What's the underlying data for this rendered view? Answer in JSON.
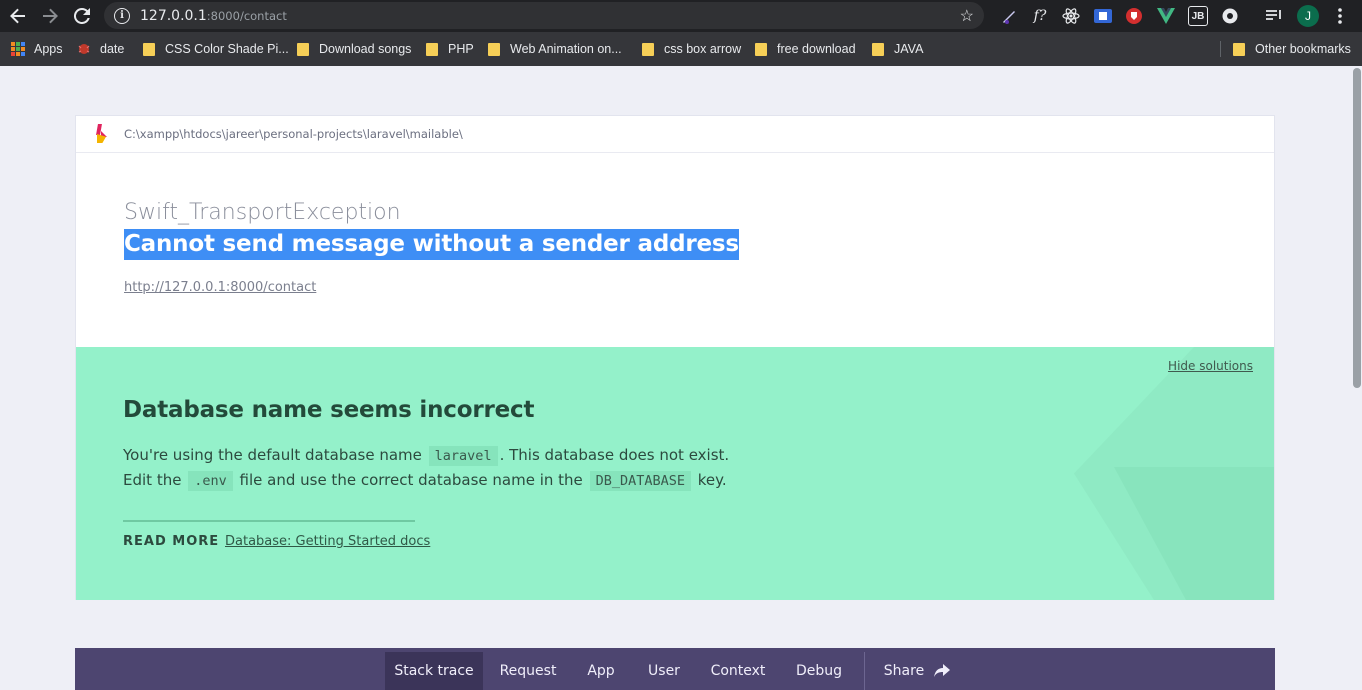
{
  "browser": {
    "url_host": "127.0.0.1",
    "url_path": ":8000/contact",
    "extensions": [
      "f?",
      "JB",
      "J"
    ],
    "bookmarks": [
      {
        "label": "Apps",
        "type": "apps"
      },
      {
        "label": "date",
        "type": "site"
      },
      {
        "label": "CSS Color Shade Pi...",
        "type": "folder"
      },
      {
        "label": "Download songs",
        "type": "folder"
      },
      {
        "label": "PHP",
        "type": "folder"
      },
      {
        "label": "Web Animation on...",
        "type": "folder"
      },
      {
        "label": "css box arrow",
        "type": "folder"
      },
      {
        "label": "free download",
        "type": "folder"
      },
      {
        "label": "JAVA",
        "type": "folder"
      },
      {
        "label": "Other bookmarks",
        "type": "folder"
      }
    ]
  },
  "page": {
    "path": "C:\\xampp\\htdocs\\jareer\\personal-projects\\laravel\\mailable\\",
    "exception_class": "Swift_TransportException",
    "exception_message": "Cannot send message without a sender address",
    "exception_url": "http://127.0.0.1:8000/contact",
    "solution": {
      "hide_label": "Hide solutions",
      "title": "Database name seems incorrect",
      "line1_a": "You're using the default database name",
      "line1_code": "laravel",
      "line1_b": ". This database does not exist.",
      "line2_a": "Edit the",
      "line2_code1": ".env",
      "line2_b": "file and use the correct database name in the",
      "line2_code2": "DB_DATABASE",
      "line2_c": "key.",
      "read_more_label": "READ MORE",
      "read_more_link": "Database: Getting Started docs"
    },
    "tabs": [
      "Stack trace",
      "Request",
      "App",
      "User",
      "Context",
      "Debug",
      "Share"
    ]
  }
}
